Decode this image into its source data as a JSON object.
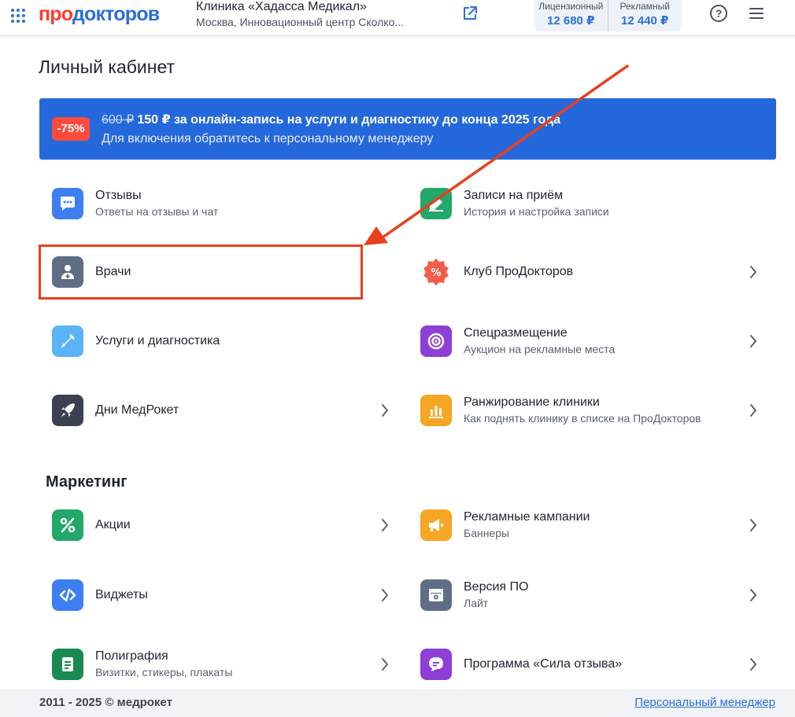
{
  "header": {
    "logo_part1": "про",
    "logo_part2": "докторов",
    "clinic_name": "Клиника «Хадасса Медикал»",
    "clinic_address": "Москва, Инновационный центр Сколко...",
    "balance": [
      {
        "label": "Лицензионный",
        "value": "12 680 ₽"
      },
      {
        "label": "Рекламный",
        "value": "12 440 ₽"
      }
    ],
    "help_symbol": "?"
  },
  "page_title": "Личный кабинет",
  "promo": {
    "badge": "-75%",
    "old_price": "600 ₽",
    "text": "150 ₽ за онлайн-запись на услуги и диагностику до конца 2025 года",
    "subtext": "Для включения обратитесь к персональному менеджеру"
  },
  "items": [
    {
      "title": "Отзывы",
      "subtitle": "Ответы на отзывы и чат",
      "icon": "chat-icon",
      "color": "#3d7ef0"
    },
    {
      "title": "Записи на приём",
      "subtitle": "История и настройка записи",
      "icon": "edit-icon",
      "color": "#22a86a"
    },
    {
      "title": "Врачи",
      "subtitle": "",
      "icon": "doctor-icon",
      "color": "#5f6e86"
    },
    {
      "title": "Клуб ПроДокторов",
      "subtitle": "",
      "icon": "discount-badge-icon",
      "color": "#f25c4a"
    },
    {
      "title": "Услуги и диагностика",
      "subtitle": "",
      "icon": "syringe-icon",
      "color": "#5ab4f5"
    },
    {
      "title": "Спецразмещение",
      "subtitle": "Аукцион на рекламные места",
      "icon": "target-icon",
      "color": "#8d3fd6"
    },
    {
      "title": "Дни МедРокет",
      "subtitle": "",
      "icon": "rocket-icon",
      "color": "#3b4150"
    },
    {
      "title": "Ранжирование клиники",
      "subtitle": "Как поднять клинику в списке на ПроДокторов",
      "icon": "bar-chart-icon",
      "color": "#f5a623"
    }
  ],
  "marketing": {
    "title": "Маркетинг",
    "items": [
      {
        "title": "Акции",
        "subtitle": "",
        "icon": "percent-icon",
        "color": "#22a86a"
      },
      {
        "title": "Рекламные кампании",
        "subtitle": "Баннеры",
        "icon": "megaphone-icon",
        "color": "#f5a623"
      },
      {
        "title": "Виджеты",
        "subtitle": "",
        "icon": "code-icon",
        "color": "#3d7ef0"
      },
      {
        "title": "Версия ПО",
        "subtitle": "Лайт",
        "icon": "settings-window-icon",
        "color": "#5f6e86"
      },
      {
        "title": "Полиграфия",
        "subtitle": "Визитки, стикеры, плакаты",
        "icon": "document-icon",
        "color": "#1a8a52"
      },
      {
        "title": "Программа «Сила отзыва»",
        "subtitle": "",
        "icon": "review-chat-icon",
        "color": "#8d3fd6"
      }
    ]
  },
  "footer": {
    "copyright": "2011 - 2025 © медрокет",
    "manager_link": "Персональный менеджер"
  },
  "colors": {
    "brand_blue": "#2a6fdb",
    "brand_red": "#ff3b30",
    "annotation": "#e8401c"
  }
}
